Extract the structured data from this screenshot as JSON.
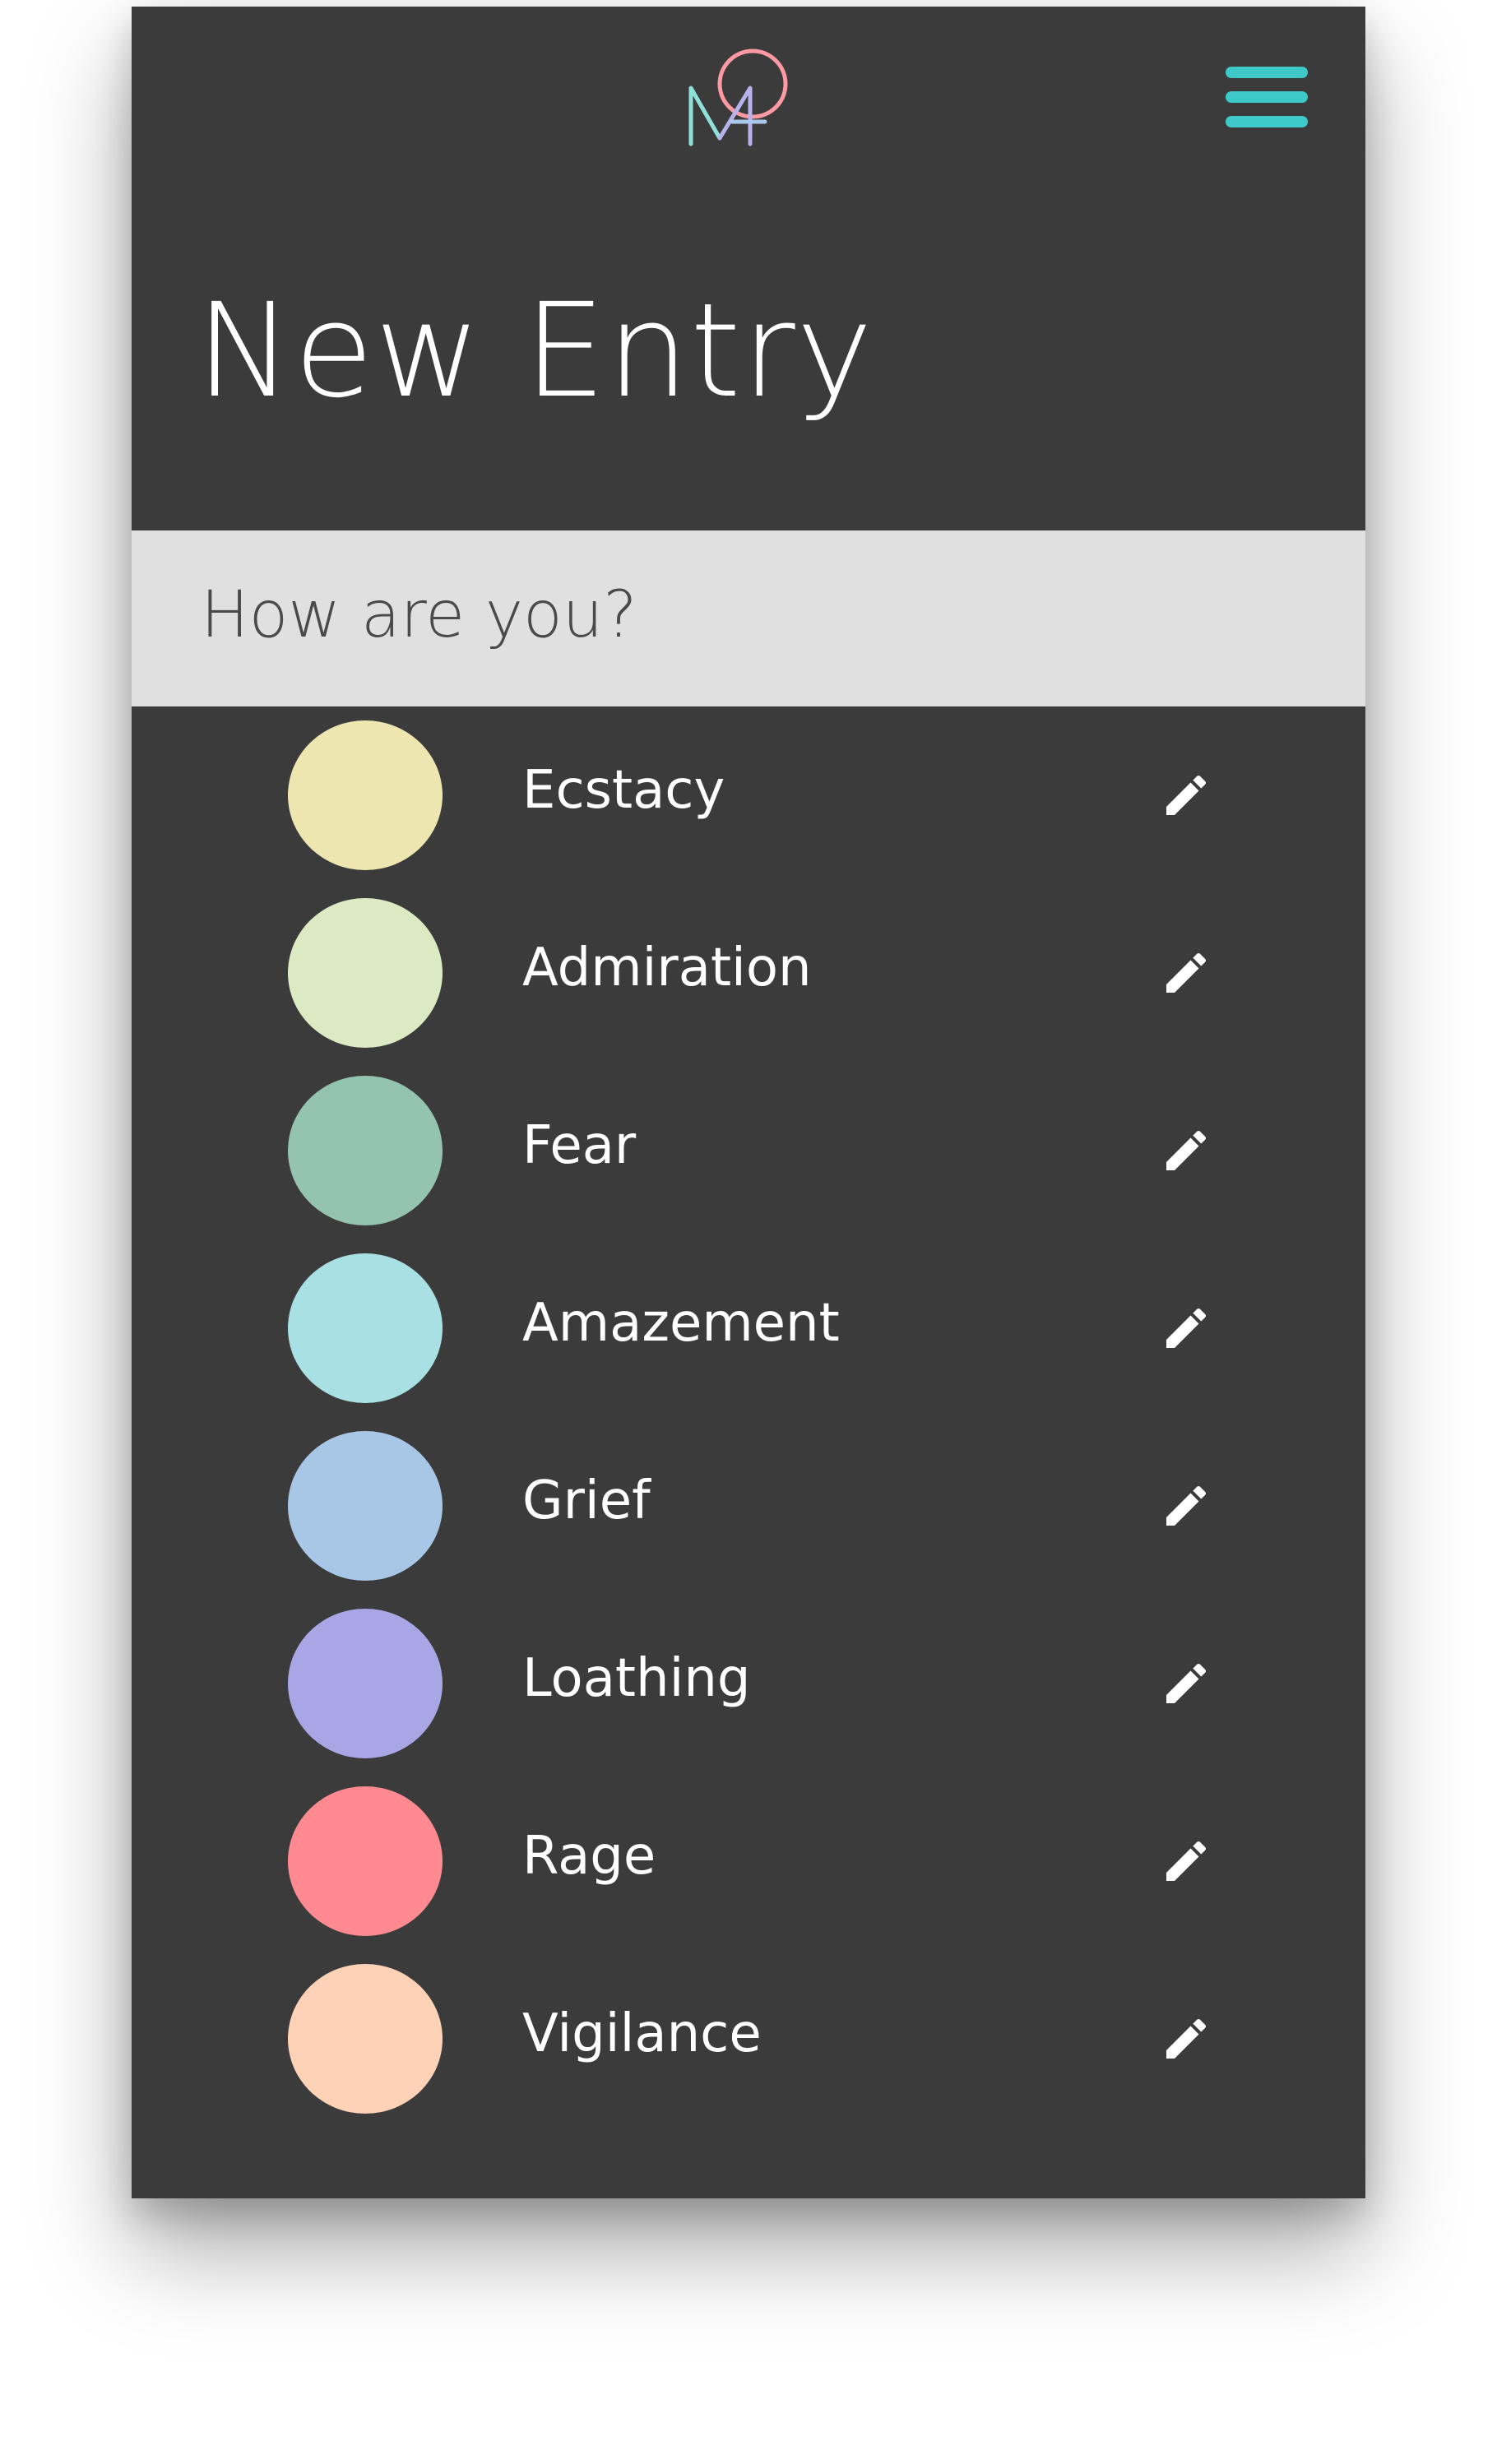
{
  "header": {
    "title": "New Entry",
    "logo_icon": "mood-logo-icon",
    "menu_icon": "hamburger-menu-icon",
    "accent_color": "#3cc9c8"
  },
  "prompt": {
    "text": "How are you?"
  },
  "emotions": [
    {
      "label": "Ecstacy",
      "color": "#ede6b1",
      "edit_icon": "pencil-icon"
    },
    {
      "label": "Admiration",
      "color": "#dbeac2",
      "edit_icon": "pencil-icon"
    },
    {
      "label": "Fear",
      "color": "#94c3af",
      "edit_icon": "pencil-icon"
    },
    {
      "label": "Amazement",
      "color": "#a8e0e3",
      "edit_icon": "pencil-icon"
    },
    {
      "label": "Grief",
      "color": "#a8c6e5",
      "edit_icon": "pencil-icon"
    },
    {
      "label": "Loathing",
      "color": "#a8a6e4",
      "edit_icon": "pencil-icon"
    },
    {
      "label": "Rage",
      "color": "#ff8a92",
      "edit_icon": "pencil-icon"
    },
    {
      "label": "Vigilance",
      "color": "#fed2b6",
      "edit_icon": "pencil-icon"
    }
  ]
}
